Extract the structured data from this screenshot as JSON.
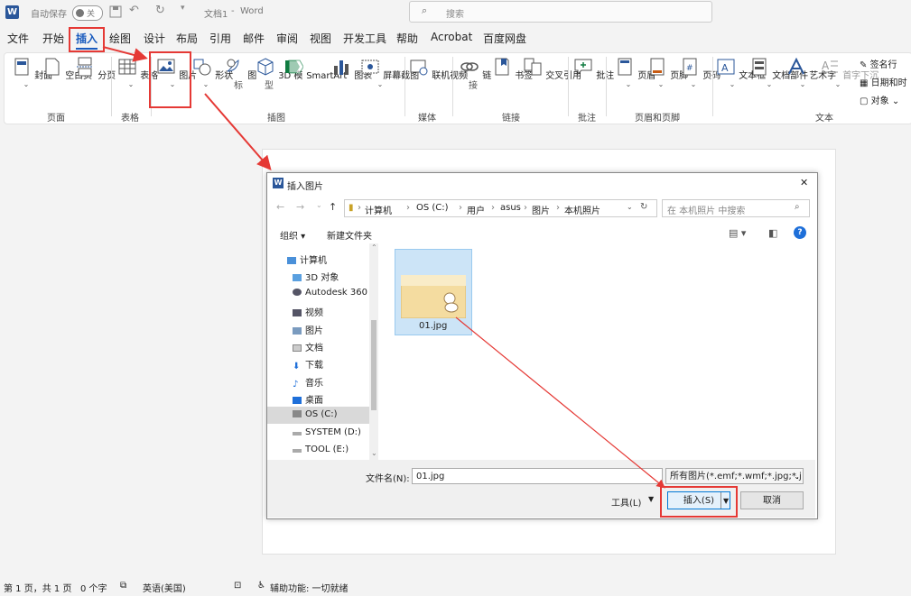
{
  "titlebar": {
    "word_icon": "W",
    "autosave_label": "自动保存",
    "autosave_state": "关",
    "doc_title": "文档1",
    "app_name": "Word",
    "separator": "-",
    "search_placeholder": "搜索"
  },
  "menu": [
    "文件",
    "开始",
    "插入",
    "绘图",
    "设计",
    "布局",
    "引用",
    "邮件",
    "审阅",
    "视图",
    "开发工具",
    "帮助",
    "Acrobat",
    "百度网盘"
  ],
  "menu_active": "插入",
  "ribbon": {
    "pages": {
      "cover": "封面",
      "blank": "空白页",
      "break": "分页",
      "group": "页面"
    },
    "table": {
      "table": "表格",
      "group": "表格"
    },
    "illus": {
      "picture": "图片",
      "shapes": "形状",
      "icons": "图\n标",
      "icons1": "图",
      "icons2": "标",
      "model1": "3D 模",
      "model2": "型",
      "smartart": "SmartArt",
      "chart": "图表",
      "screenshot": "屏幕截图",
      "group": "插图"
    },
    "media": {
      "video": "联机视频",
      "group": "媒体"
    },
    "links": {
      "link1": "链",
      "link2": "接",
      "bookmark": "书签",
      "xref": "交叉引用",
      "group": "链接"
    },
    "comments": {
      "comment": "批注",
      "group": "批注"
    },
    "headerfooter": {
      "header": "页眉",
      "footer": "页脚",
      "pagenum": "页码",
      "group": "页眉和页脚"
    },
    "text": {
      "textbox": "文本框",
      "parts": "文档部件",
      "wordart": "艺术字",
      "dropcap": "首字下沉",
      "group": "文本",
      "sigline": "签名行",
      "datetime": "日期和时",
      "object": "对象"
    }
  },
  "dialog": {
    "title": "插入图片",
    "path": [
      "计算机",
      "OS (C:)",
      "用户",
      "asus",
      "图片",
      "本机照片"
    ],
    "search_placeholder": "在 本机照片 中搜索",
    "organize": "组织 ▾",
    "new_folder": "新建文件夹",
    "nav_items": [
      "计算机",
      "3D 对象",
      "Autodesk 360",
      "视频",
      "图片",
      "文档",
      "下载",
      "音乐",
      "桌面",
      "OS (C:)",
      "SYSTEM (D:)",
      "TOOL (E:)"
    ],
    "file_name": "01.jpg",
    "filename_label": "文件名(N):",
    "filename_value": "01.jpg",
    "filter": "所有图片(*.emf;*.wmf;*.jpg;*.j",
    "tools": "工具(L)",
    "insert": "插入(S)",
    "cancel": "取消",
    "close": "✕",
    "help": "?"
  },
  "status": {
    "page": "第 1 页，共 1 页",
    "words": "0 个字",
    "lang": "英语(美国)",
    "accessibility": "辅助功能: 一切就绪"
  },
  "colors": {
    "accent": "#185abd",
    "highlight": "#e53935",
    "word_blue": "#2b579a"
  }
}
